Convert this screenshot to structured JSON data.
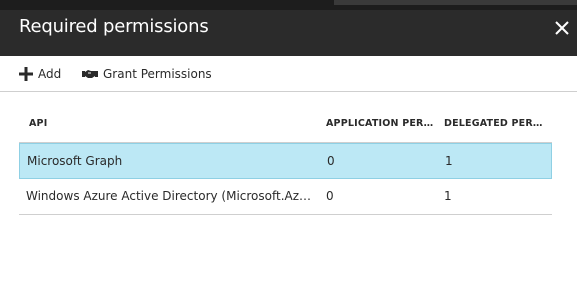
{
  "header": {
    "title": "Required permissions",
    "close_icon": "close-icon"
  },
  "toolbar": {
    "add_label": "Add",
    "add_icon": "plus-icon",
    "grant_label": "Grant Permissions",
    "grant_icon": "handshake-icon"
  },
  "table": {
    "columns": [
      {
        "label": "API"
      },
      {
        "label": "APPLICATION PERMISSIONS"
      },
      {
        "label": "DELEGATED PERMISSIONS"
      }
    ],
    "rows": [
      {
        "api": "Microsoft Graph",
        "application": "0",
        "delegated": "1",
        "selected": true
      },
      {
        "api": "Windows Azure Active Directory (Microsoft.Azure.ActiveDirectory)",
        "application": "0",
        "delegated": "1",
        "selected": false
      }
    ]
  },
  "colors": {
    "header_bg": "#2b2b2b",
    "top_strip": "#1d1d1d",
    "selected_row_bg": "#bce8f5",
    "selected_row_border": "#8fd0e4",
    "divider": "#cfcfcf"
  }
}
